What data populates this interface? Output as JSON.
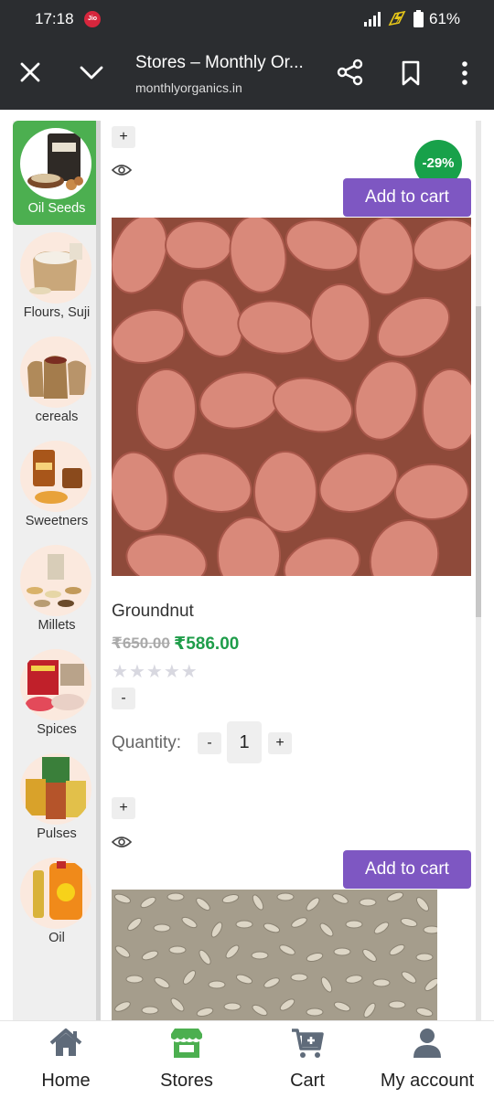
{
  "status": {
    "time": "17:18",
    "carrier_badge": "Jio",
    "battery": "61%"
  },
  "browser": {
    "title": "Stores – Monthly Or...",
    "url": "monthlyorganics.in"
  },
  "sidebar": {
    "items": [
      {
        "label": "Oil Seeds",
        "active": true
      },
      {
        "label": "Flours, Suji",
        "active": false
      },
      {
        "label": "cereals",
        "active": false
      },
      {
        "label": "Sweetners",
        "active": false
      },
      {
        "label": "Millets",
        "active": false
      },
      {
        "label": "Spices",
        "active": false
      },
      {
        "label": "Pulses",
        "active": false
      },
      {
        "label": "Oil",
        "active": false
      }
    ]
  },
  "products": [
    {
      "plus": "+",
      "discount": "-29%",
      "add_to_cart": "Add to cart",
      "name": "Groundnut",
      "old_price": "₹650.00",
      "new_price": "₹586.00",
      "rating": 0,
      "minus": "-",
      "quantity_label": "Quantity:",
      "qty_minus": "-",
      "quantity": "1",
      "qty_plus": "+"
    },
    {
      "plus": "+",
      "add_to_cart": "Add to cart"
    }
  ],
  "bottom_nav": [
    {
      "label": "Home",
      "icon": "home-icon"
    },
    {
      "label": "Stores",
      "icon": "store-icon",
      "color": "#4caf50"
    },
    {
      "label": "Cart",
      "icon": "cart-icon"
    },
    {
      "label": "My account",
      "icon": "account-icon"
    }
  ],
  "colors": {
    "accent_purple": "#7e57c2",
    "active_green": "#4caf50",
    "price_green": "#1f9d4a"
  }
}
